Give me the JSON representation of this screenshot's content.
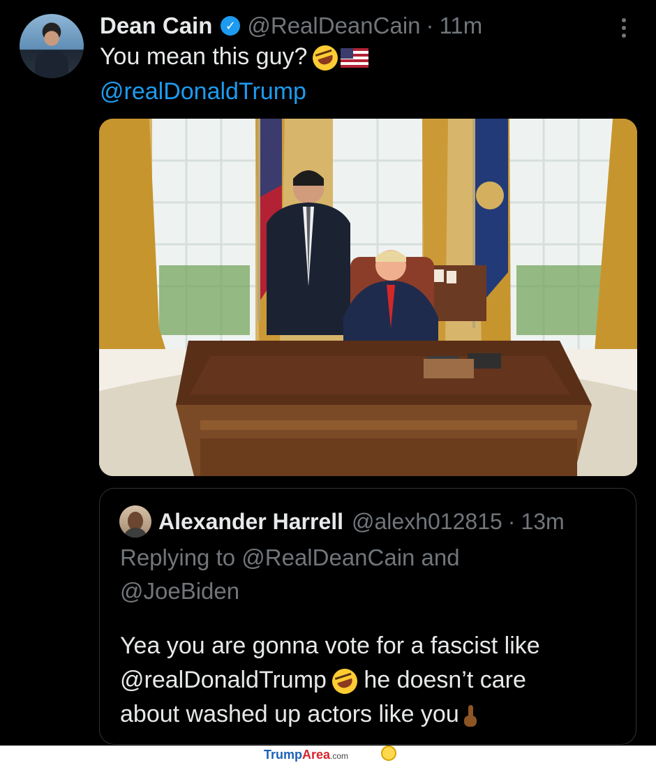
{
  "tweet": {
    "display_name": "Dean Cain",
    "verified_symbol": "✓",
    "handle": "@RealDeanCain",
    "separator": "·",
    "time": "11m",
    "text_line1": "You mean this guy?",
    "mention_line": "@realDonaldTrump"
  },
  "quote": {
    "display_name": "Alexander Harrell",
    "handle": "@alexh012815",
    "separator": "·",
    "time": "13m",
    "reply_line1": "Replying to @RealDeanCain and",
    "reply_line2": "@JoeBiden",
    "text_line1": "Yea you are gonna vote for a fascist like",
    "text_line2_mention": "@realDonaldTrump",
    "text_line2_rest": "he doesn’t care",
    "text_line3": "about washed up actors like you"
  },
  "footer": {
    "brand_part1": "Trump",
    "brand_part2": "Area",
    "brand_part3": ".com"
  },
  "icons": {
    "verified": "verified-badge-icon",
    "more": "more-options-icon",
    "laugh": "rolling-laugh-emoji-icon",
    "flag": "us-flag-emoji-icon",
    "finger": "hand-gesture-emoji-icon"
  },
  "colors": {
    "background": "#000000",
    "text": "#e7e9ea",
    "muted": "#71767b",
    "link": "#1d9bf0",
    "verified": "#1d9bf0"
  }
}
